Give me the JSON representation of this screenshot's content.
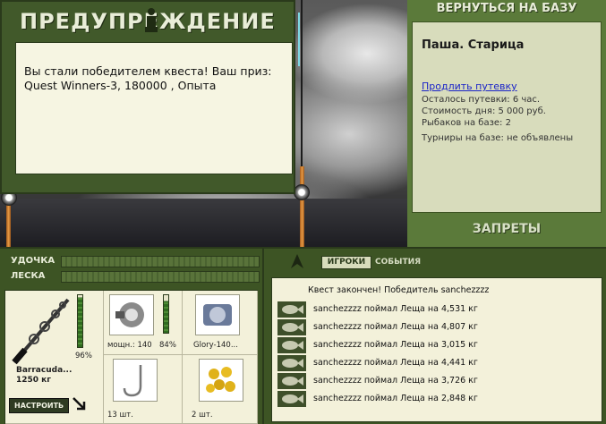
{
  "modal": {
    "title": "ПРЕДУПРЕЖДЕНИЕ",
    "message_line1": "Вы стали победителем квеста! Ваш приз:",
    "message_line2": "Quest Winners-3, 180000 , Опыта"
  },
  "base_panel": {
    "back_label": "ВЕРНУТЬСЯ НА БАЗУ",
    "base_name": "Паша. Старица",
    "extend_link": "Продлить путевку",
    "time_left": "Осталось путевки: 6 час.",
    "day_cost": "Стоимость дня: 5 000 руб.",
    "fishers": "Рыбаков на базе: 2",
    "tournaments": "Турниры на базе: не объявлены",
    "bans_label": "ЗАПРЕТЫ"
  },
  "gear": {
    "rod_meter_label": "УДОЧКА",
    "line_meter_label": "ЛЕСКА",
    "rod_percent": "96%",
    "rod_percent_value": 96,
    "rod_name": "Barracuda...",
    "rod_weight": "1250 кг",
    "setup_label": "НАСТРОИТЬ",
    "reel_power": "мощн.: 140",
    "reel_percent": "84%",
    "reel_percent_value": 84,
    "line_name": "Glory-140...",
    "hook_count": "13 шт.",
    "bait_count": "2 шт."
  },
  "chat": {
    "tab_players": "ИГРОКИ",
    "tab_events": "СОБЫТИЯ",
    "headline": "Квест закончен! Победитель sanchezzzz",
    "rows": [
      "sanchezzzz поймал Леща на 4,531 кг",
      "sanchezzzz поймал Леща на 4,807 кг",
      "sanchezzzz поймал Леща на 3,015 кг",
      "sanchezzzz поймал Леща на 4,441 кг",
      "sanchezzzz поймал Леща на 3,726 кг",
      "sanchezzzz поймал Леща на 2,848 кг"
    ]
  },
  "colors": {
    "panel_green": "#3d5424",
    "light_green": "#5b7a3a",
    "cream": "#f3f1da",
    "link_blue": "#1a23c8"
  }
}
